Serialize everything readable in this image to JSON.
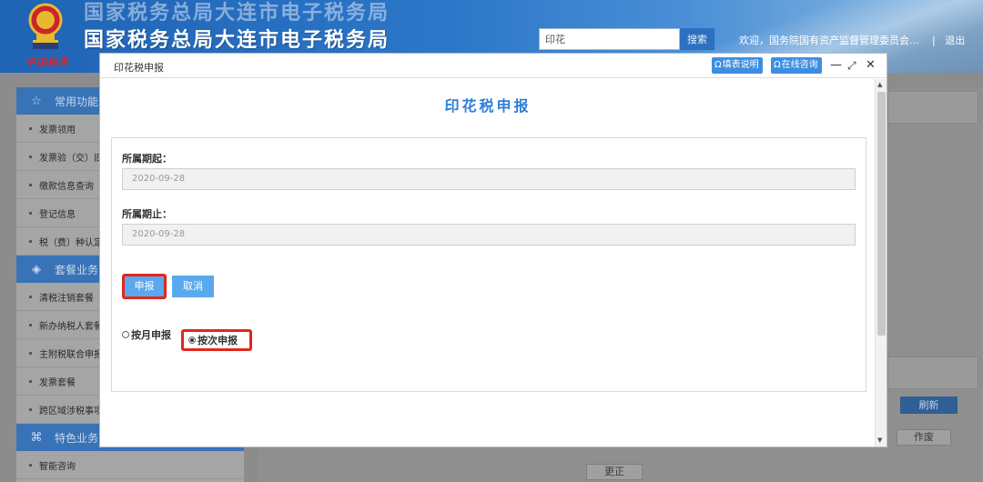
{
  "header": {
    "title": "国家税务总局大连市电子税务局",
    "brand_script": "中国税务",
    "search_value": "印花",
    "search_button": "搜索",
    "welcome": "欢迎，国务院国有资产监督管理委员会...",
    "logout": "退出"
  },
  "sidebar": {
    "groups": [
      {
        "label": "常用功能",
        "icon": "star-icon",
        "items": [
          "发票领用",
          "发票验（交）旧",
          "缴款信息查询",
          "登记信息",
          "税（费）种认定信息"
        ]
      },
      {
        "label": "套餐业务",
        "icon": "layers-icon",
        "items": [
          "清税注销套餐",
          "新办纳税人套餐",
          "主附税联合申报",
          "发票套餐",
          "跨区域涉税事项"
        ]
      },
      {
        "label": "特色业务",
        "icon": "command-icon",
        "items": [
          "智能咨询"
        ]
      }
    ]
  },
  "background": {
    "refresh": "刷新",
    "void": "作废",
    "correct": "更正"
  },
  "modal": {
    "title": "印花税申报",
    "help_button": "填表说明",
    "consult_button": "在线咨询",
    "heading": "印花税申报",
    "period_start_label": "所属期起：",
    "period_start_value": "2020-09-28",
    "period_end_label": "所属期止：",
    "period_end_value": "2020-09-28",
    "submit": "申报",
    "cancel": "取消",
    "radio_monthly": "按月申报",
    "radio_per_time": "按次申报",
    "selected_option": "按次申报"
  }
}
